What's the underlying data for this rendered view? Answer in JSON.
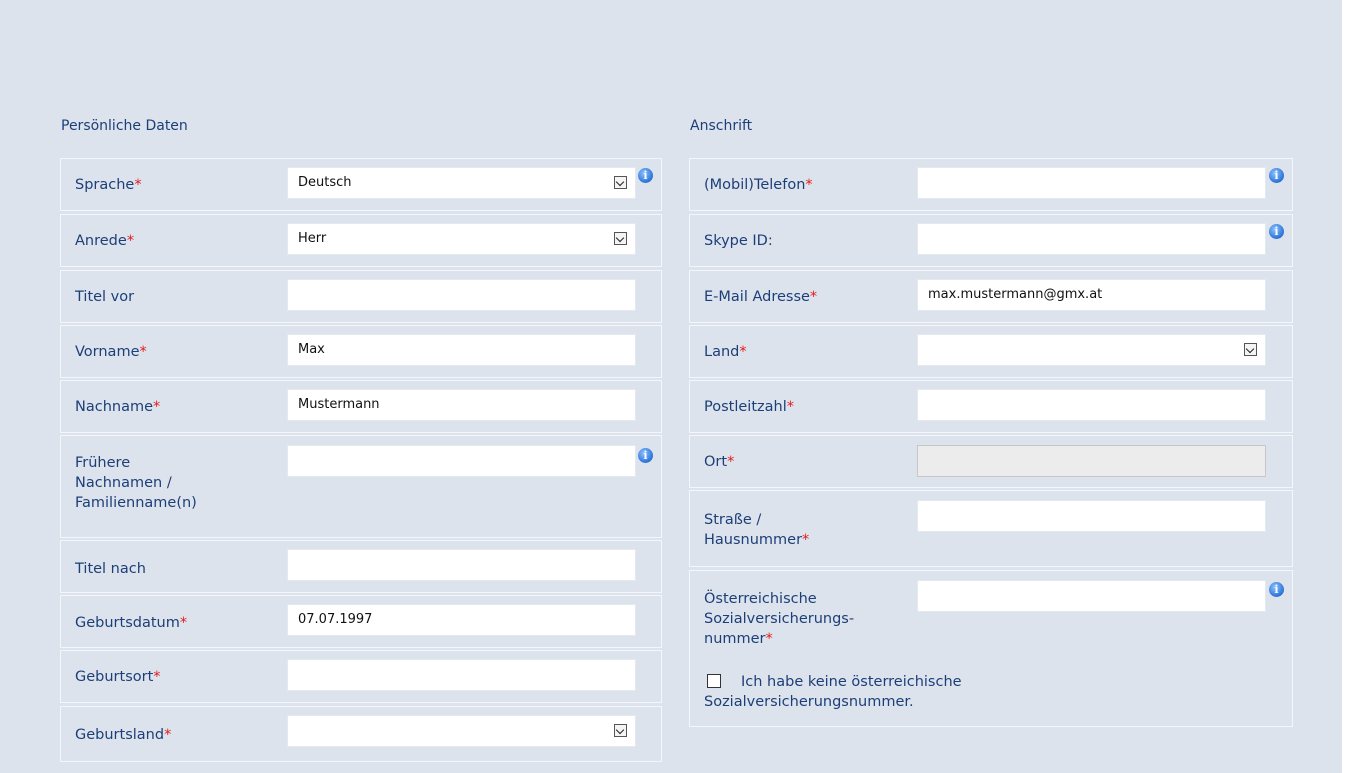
{
  "personal": {
    "title": "Persönliche Daten",
    "sprache": {
      "label": "Sprache",
      "value": "Deutsch"
    },
    "anrede": {
      "label": "Anrede",
      "value": "Herr"
    },
    "titel_vor": {
      "label": "Titel vor",
      "value": ""
    },
    "vorname": {
      "label": "Vorname",
      "value": "Max"
    },
    "nachname": {
      "label": "Nachname",
      "value": "Mustermann"
    },
    "fruehere": {
      "label_lines": [
        "Frühere",
        "Nachnamen /",
        "Familienname(n)"
      ],
      "value": ""
    },
    "titel_nach": {
      "label": "Titel nach",
      "value": ""
    },
    "geburtsdatum": {
      "label": "Geburtsdatum",
      "value": "07.07.1997"
    },
    "geburtsort": {
      "label": "Geburtsort",
      "value": ""
    },
    "geburtsland": {
      "label": "Geburtsland",
      "value": ""
    }
  },
  "address": {
    "title": "Anschrift",
    "telefon": {
      "label": "(Mobil)Telefon",
      "value": ""
    },
    "skype": {
      "label": "Skype ID:",
      "value": ""
    },
    "email": {
      "label": "E-Mail Adresse",
      "value": "max.mustermann@gmx.at"
    },
    "land": {
      "label": "Land",
      "value": ""
    },
    "plz": {
      "label": "Postleitzahl",
      "value": ""
    },
    "ort": {
      "label": "Ort",
      "value": ""
    },
    "strasse": {
      "label_lines": [
        "Straße /",
        "Hausnummer"
      ],
      "value": ""
    },
    "svnr": {
      "label_lines": [
        "Österreichische",
        "Sozialversicherungs-",
        "nummer"
      ],
      "value": ""
    },
    "no_svnr": {
      "label_lines": [
        "Ich habe keine österreichische",
        "Sozialversicherungsnummer."
      ],
      "checked": false
    }
  },
  "required_marker": "*",
  "info_glyph": "i",
  "icons": {
    "dropdown": "chevron-down-icon",
    "info": "info-icon"
  },
  "colors": {
    "background": "#dde3ec",
    "label": "#1c3f78",
    "required": "#e21b1b",
    "info": "#2a72d6"
  }
}
